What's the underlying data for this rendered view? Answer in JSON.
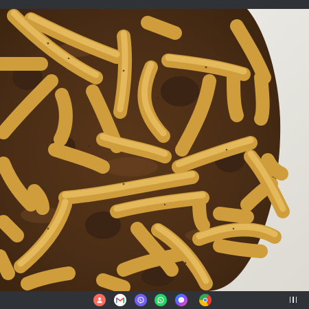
{
  "topbar": {},
  "photo": {
    "subject": "pasta-with-meat-sauce",
    "colors": {
      "plate": "#ecebe6",
      "sauce": "#4a2d15",
      "sauce_highlight": "#6b4322",
      "pasta": "#dcae4a",
      "pasta_light": "#ecc66a",
      "meat": "#3b2413"
    }
  },
  "taskbar": {
    "apps": [
      {
        "name": "contacts-app-icon",
        "color": "#ff6a5a"
      },
      {
        "name": "gmail-app-icon",
        "color": "#ffffff"
      },
      {
        "name": "viber-app-icon",
        "color": "#7360f2"
      },
      {
        "name": "whatsapp-app-icon",
        "color": "#25d366"
      },
      {
        "name": "messenger-app-icon",
        "color": "#a044ff"
      },
      {
        "name": "chrome-app-icon",
        "color": "#ffffff"
      }
    ],
    "recents_icon": "recents-icon"
  }
}
